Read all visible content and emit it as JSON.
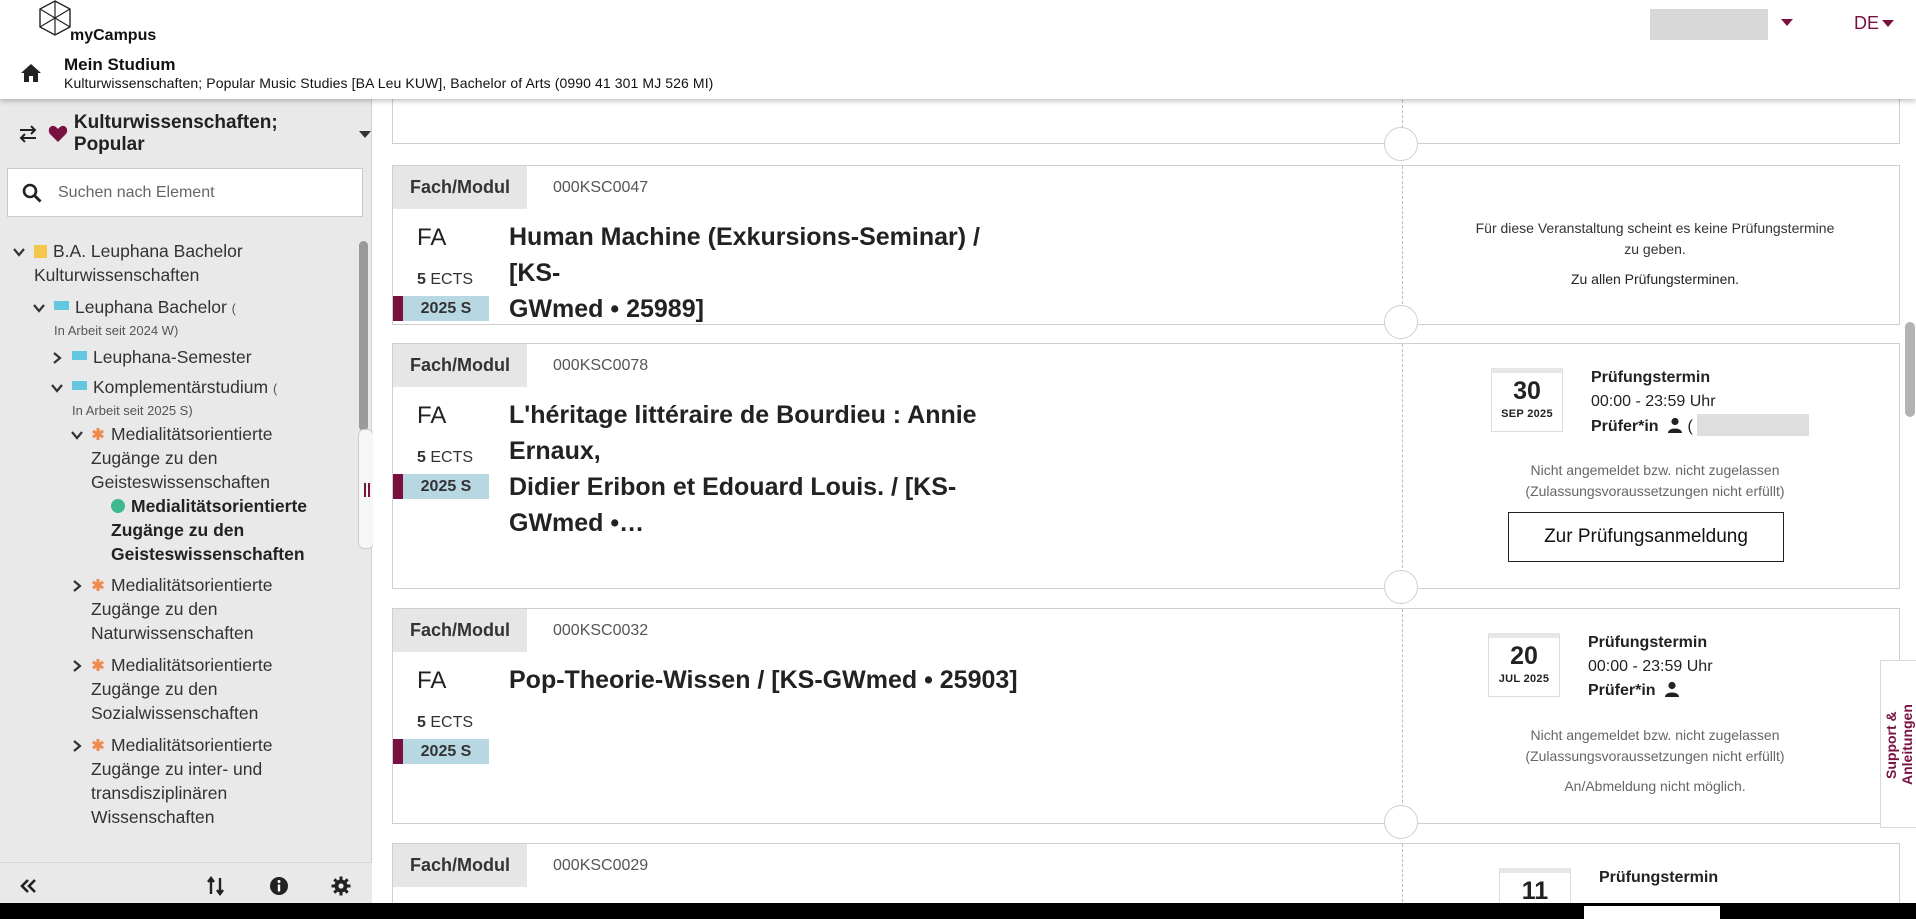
{
  "header": {
    "brand": "myCampus",
    "title": "Mein Studium",
    "subtitle": "Kulturwissenschaften; Popular Music Studies [BA Leu KUW], Bachelor of Arts (0990 41 301 MJ 526 MI)",
    "language": "DE"
  },
  "sidebar": {
    "title": "Kulturwissenschaften; Popular",
    "search_placeholder": "Suchen nach Element",
    "tree": {
      "n1": "B.A. Leuphana Bachelor",
      "n1b": "Kulturwissenschaften",
      "n2": "Leuphana Bachelor",
      "n2paren": "(",
      "n2sub": "In Arbeit seit 2024 W)",
      "n3": "Leuphana-Semester",
      "n4": "Komplementärstudium",
      "n4paren": "(",
      "n4sub": "In Arbeit seit 2025 S)",
      "n5a": "Medialitätsorientierte",
      "n5b": "Zugänge zu den",
      "n5c": "Geisteswissenschaften",
      "n6a": "Medialitätsorientierte",
      "n6b": "Zugänge zu den",
      "n6c": "Geisteswissenschaften",
      "n7a": "Medialitätsorientierte",
      "n7b": "Zugänge zu den",
      "n7c": "Naturwissenschaften",
      "n8a": "Medialitätsorientierte",
      "n8b": "Zugänge zu den",
      "n8c": "Sozialwissenschaften",
      "n9a": "Medialitätsorientierte",
      "n9b": "Zugänge zu inter- und",
      "n9c": "transdisziplinären",
      "n9d": "Wissenschaften"
    }
  },
  "cards": [
    {
      "label": "Fach/Modul",
      "code": "000KSC0047",
      "type": "FA",
      "ects_num": "5",
      "ects_unit": "ECTS",
      "semester": "2025 S",
      "title_l1": "Human Machine (Exkursions-Seminar) / [KS-",
      "title_l2": "GWmed • 25989]",
      "no_exam_l1": "Für diese Veranstaltung scheint es keine Prüfungstermine",
      "no_exam_l2": "zu geben.",
      "all_exams_link": "Zu allen Prüfungsterminen."
    },
    {
      "label": "Fach/Modul",
      "code": "000KSC0078",
      "type": "FA",
      "ects_num": "5",
      "ects_unit": "ECTS",
      "semester": "2025 S",
      "title_l1": "L'héritage littéraire de Bourdieu : Annie Ernaux,",
      "title_l2": "Didier Eribon et Edouard Louis. / [KS-GWmed •…",
      "date_day": "30",
      "date_mon": "SEP 2025",
      "exam_label": "Prüfungstermin",
      "exam_time": "00:00 - 23:59 Uhr",
      "examiner_label": "Prüfer*in",
      "examiner_paren": "(",
      "status_l1": "Nicht angemeldet bzw. nicht zugelassen",
      "status_l2": "(Zulassungsvoraussetzungen nicht erfüllt)",
      "button": "Zur Prüfungsanmeldung"
    },
    {
      "label": "Fach/Modul",
      "code": "000KSC0032",
      "type": "FA",
      "ects_num": "5",
      "ects_unit": "ECTS",
      "semester": "2025 S",
      "title_l1": "Pop-Theorie-Wissen / [KS-GWmed • 25903]",
      "date_day": "20",
      "date_mon": "JUL 2025",
      "exam_label": "Prüfungstermin",
      "exam_time": "00:00 - 23:59 Uhr",
      "examiner_label": "Prüfer*in",
      "status_l1": "Nicht angemeldet bzw. nicht zugelassen",
      "status_l2": "(Zulassungsvoraussetzungen nicht erfüllt)",
      "status_l3": "An/Abmeldung nicht möglich."
    },
    {
      "label": "Fach/Modul",
      "code": "000KSC0029",
      "date_day": "11",
      "exam_label": "Prüfungstermin"
    }
  ],
  "support_tab": "Support & Anleitungen",
  "colors": {
    "accent": "#7a1040",
    "semester_bg": "#b7d7e3",
    "label_bg": "#e6e6e6",
    "sidebar_bg": "#e9e9e9",
    "green_dot": "#3fb98f",
    "orange_asterisk": "#ee8a4b",
    "blue_square": "#63c7df",
    "yellow_square": "#f5c64c"
  },
  "icons": [
    "cube-logo-icon",
    "home-icon",
    "swap-icon",
    "heart-icon",
    "search-icon",
    "chevron-down-icon",
    "chevron-right-icon",
    "asterisk-icon",
    "double-chevron-left-icon",
    "sort-icon",
    "info-icon",
    "gear-icon",
    "user-icon"
  ]
}
